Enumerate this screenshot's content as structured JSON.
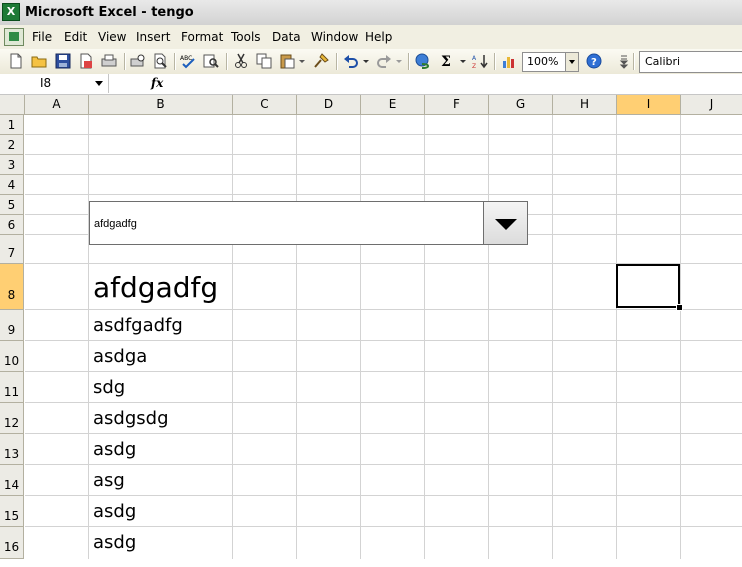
{
  "window": {
    "title": "Microsoft Excel - tengo"
  },
  "menu": [
    "File",
    "Edit",
    "View",
    "Insert",
    "Format",
    "Tools",
    "Data",
    "Window",
    "Help"
  ],
  "toolbar": {
    "zoom": "100%",
    "font": "Calibri"
  },
  "formula": {
    "name_box": "I8",
    "fx_label": "fx",
    "content": ""
  },
  "columns": [
    "A",
    "B",
    "C",
    "D",
    "E",
    "F",
    "G",
    "H",
    "I",
    "J"
  ],
  "active_column": "I",
  "rows": [
    "1",
    "2",
    "3",
    "4",
    "5",
    "6",
    "7",
    "8",
    "9",
    "10",
    "11",
    "12",
    "13",
    "14",
    "15",
    "16"
  ],
  "active_row": "8",
  "combo": {
    "value": "afdgadfg"
  },
  "cells": [
    {
      "row": "8",
      "text": "afdgadfg"
    },
    {
      "row": "9",
      "text": "asdfgadfg"
    },
    {
      "row": "10",
      "text": "asdga"
    },
    {
      "row": "11",
      "text": "sdg"
    },
    {
      "row": "12",
      "text": "asdgsdg"
    },
    {
      "row": "13",
      "text": "asdg"
    },
    {
      "row": "14",
      "text": "asg"
    },
    {
      "row": "15",
      "text": "asdg"
    },
    {
      "row": "16",
      "text": "asdg"
    }
  ]
}
